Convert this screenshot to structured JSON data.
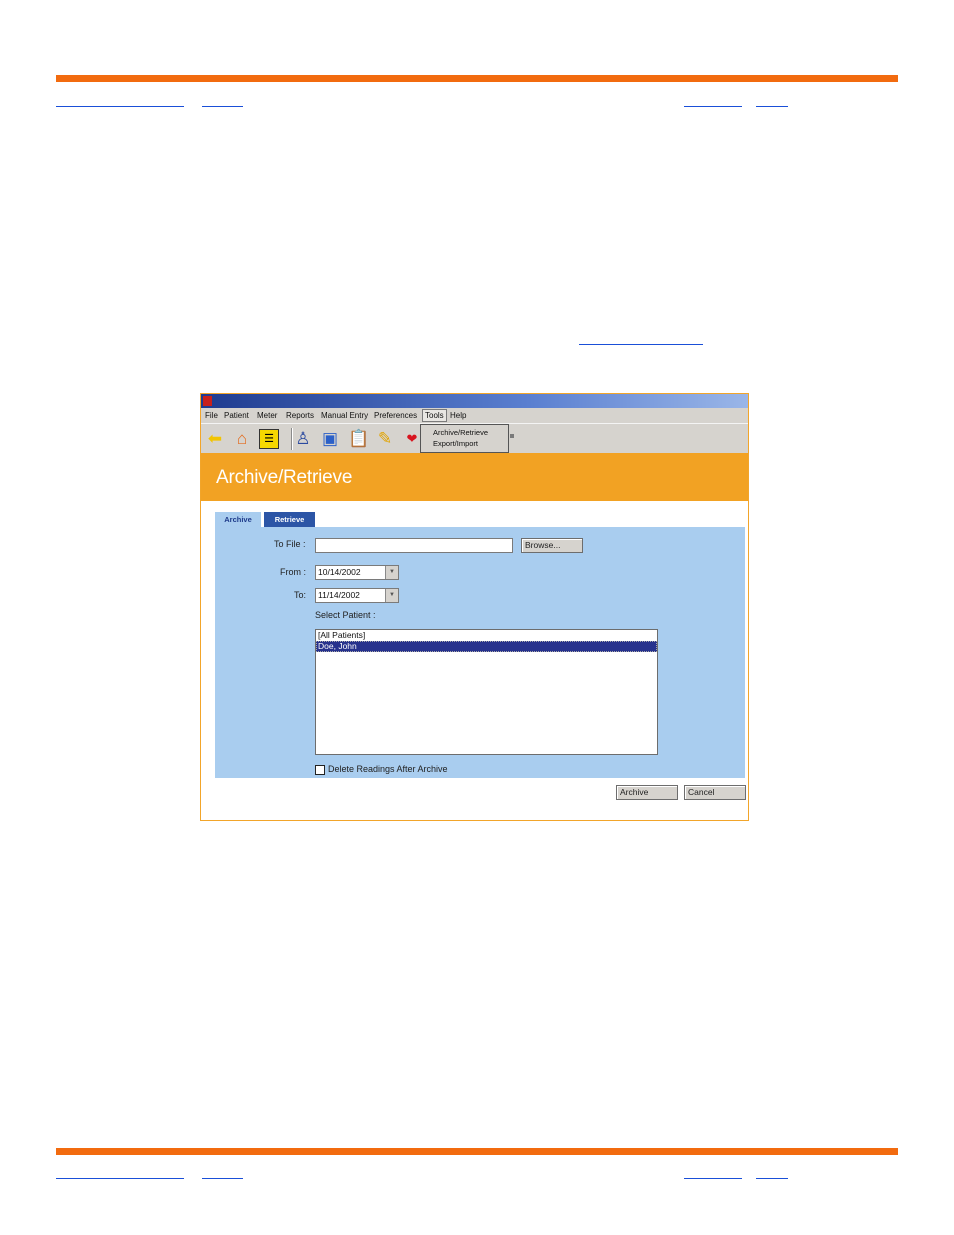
{
  "app": {
    "menu": [
      "File",
      "Patient",
      "Meter",
      "Reports",
      "Manual Entry",
      "Preferences",
      "Tools",
      "Help"
    ],
    "tools_menu": [
      "Archive/Retrieve",
      "Export/Import"
    ],
    "toolbar_icons": [
      "back-arrow-icon",
      "home-icon",
      "checklist-icon",
      "person-icon",
      "meter-icon",
      "clipboard-icon",
      "pencil-icon",
      "heart-icon"
    ],
    "page_title": "Archive/Retrieve",
    "tabs": [
      "Archive",
      "Retrieve"
    ],
    "to_file_label": "To File :",
    "to_file_value": "",
    "browse_label": "Browse...",
    "from_label": "From :",
    "from_value": "10/14/2002",
    "to_label": "To:",
    "to_value": "11/14/2002",
    "select_patient_label": "Select Patient :",
    "patients": [
      "[All Patients]",
      "Doe, John"
    ],
    "selected_patient": "Doe, John",
    "delete_readings_label": "Delete Readings After Archive",
    "delete_readings_checked": false,
    "archive_button": "Archive",
    "cancel_button": "Cancel"
  },
  "colors": {
    "rule": "#f26b0f",
    "banner": "#f2a223",
    "panel": "#a9cdef",
    "tab_inactive": "#2c55a6",
    "selection": "#27328d"
  }
}
